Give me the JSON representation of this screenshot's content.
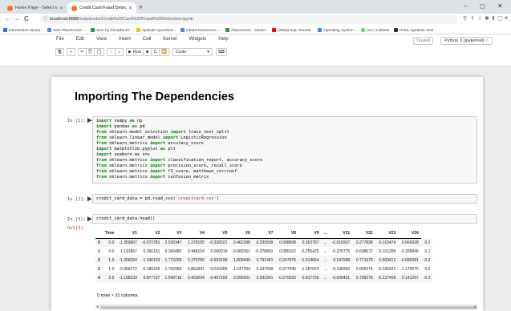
{
  "browser": {
    "tabs": [
      {
        "label": "Home Page - Select or create a n",
        "icon_color": "#f37626"
      },
      {
        "label": "Credit Card Fraud Detection - Ju",
        "icon_color": "#f37626"
      }
    ],
    "new_tab": "+",
    "window_controls": [
      "–",
      "◻",
      "✕"
    ],
    "nav": {
      "back": "←",
      "forward": "→",
      "reload": "C",
      "home": "⌂"
    },
    "url_host": "localhost:8888",
    "url_path": "/notebooks/Credit%20Card%20Fraud%20Detection.ipynb",
    "right_icons": [
      "⚲",
      "⇪",
      "☆",
      "✱",
      "⬇",
      "▢",
      "●"
    ],
    "bookmarks": [
      {
        "label": "Introduction: Boots...",
        "color": "#1a73e8"
      },
      {
        "label": "Tech Placements -...",
        "color": "#4285f4"
      },
      {
        "label": "DSA by Shradha Di...",
        "color": "#0f9d58"
      },
      {
        "label": "Aptitude Questions...",
        "color": "#fbbc05"
      },
      {
        "label": "DBMS Resources -...",
        "color": "#4285f4"
      },
      {
        "label": "Placements - Geeks...",
        "color": "#2f8d46"
      },
      {
        "label": "(2568) SQL Tutorial...",
        "color": "#ff0000"
      },
      {
        "label": "Operating System...",
        "color": "#4285f4"
      },
      {
        "label": "Live | Linktree",
        "color": "#43e55e"
      },
      {
        "label": "HTML Symbols, Enti...",
        "color": "#333333"
      }
    ]
  },
  "jupyter": {
    "menu": [
      "File",
      "Edit",
      "View",
      "Insert",
      "Cell",
      "Kernel",
      "Widgets",
      "Help"
    ],
    "trusted": "Trusted",
    "kernel": "Python 3 (ipykernel)",
    "kernel_indicator": "○",
    "toolbar": {
      "save": "🖫",
      "add": "+",
      "cut": "✂",
      "copy": "⎘",
      "paste": "📋",
      "up": "↑",
      "down": "↓",
      "run": "▶ Run",
      "stop": "■",
      "restart": "C",
      "restart_run": "⏩",
      "cell_type": "Code",
      "keyboard": "⌨"
    }
  },
  "notebook": {
    "heading": "Importing The Dependencies",
    "cells": [
      {
        "prompt": "In [1]:",
        "lines": [
          [
            [
              "kw",
              "import"
            ],
            [
              "t",
              " numpy "
            ],
            [
              "kw",
              "as"
            ],
            [
              "t",
              " np"
            ]
          ],
          [
            [
              "kw",
              "import"
            ],
            [
              "t",
              " pandas "
            ],
            [
              "kw",
              "as"
            ],
            [
              "t",
              " pd"
            ]
          ],
          [
            [
              "kw",
              "from"
            ],
            [
              "t",
              " sklearn.model_selection "
            ],
            [
              "kw",
              "import"
            ],
            [
              "t",
              " train_test_split"
            ]
          ],
          [
            [
              "kw",
              "from"
            ],
            [
              "t",
              " sklearn.linear_model "
            ],
            [
              "kw",
              "import"
            ],
            [
              "t",
              " LogisticRegression"
            ]
          ],
          [
            [
              "kw",
              "from"
            ],
            [
              "t",
              " sklearn.metrics "
            ],
            [
              "kw",
              "import"
            ],
            [
              "t",
              " accuracy_score"
            ]
          ],
          [
            [
              "kw",
              "import"
            ],
            [
              "t",
              " matplotlib.pyplot "
            ],
            [
              "kw",
              "as"
            ],
            [
              "t",
              " plt"
            ]
          ],
          [
            [
              "kw",
              "import"
            ],
            [
              "t",
              " seaborn "
            ],
            [
              "kw",
              "as"
            ],
            [
              "t",
              " sns"
            ]
          ],
          [
            [
              "kw",
              "from"
            ],
            [
              "t",
              " sklearn.metrics "
            ],
            [
              "kw",
              "import"
            ],
            [
              "t",
              " classification_report, accuracy_score"
            ]
          ],
          [
            [
              "kw",
              "from"
            ],
            [
              "t",
              " sklearn.metrics "
            ],
            [
              "kw",
              "import"
            ],
            [
              "t",
              " precision_score, recall_score"
            ]
          ],
          [
            [
              "kw",
              "from"
            ],
            [
              "t",
              " sklearn.metrics "
            ],
            [
              "kw",
              "import"
            ],
            [
              "t",
              " f1_score, matthews_corrcoef"
            ]
          ],
          [
            [
              "kw",
              "from"
            ],
            [
              "t",
              " sklearn.metrics "
            ],
            [
              "kw",
              "import"
            ],
            [
              "t",
              " confusion_matrix"
            ]
          ]
        ]
      },
      {
        "prompt": "In [2]:",
        "lines": [
          [
            [
              "t",
              "credit_card_data = pd.read_csv("
            ],
            [
              "str",
              "'creditcard.csv'"
            ],
            [
              "t",
              ")"
            ]
          ]
        ]
      },
      {
        "prompt": "In [3]:",
        "lines": [
          [
            [
              "t",
              "credit_card_data.head()"
            ]
          ]
        ]
      }
    ],
    "out_prompt": "Out[3]:",
    "dataframe": {
      "columns": [
        "",
        "Time",
        "V1",
        "V2",
        "V3",
        "V4",
        "V5",
        "V6",
        "V7",
        "V8",
        "V9",
        "...",
        "V21",
        "V22",
        "V23",
        "V24"
      ],
      "rows": [
        [
          "0",
          "0.0",
          "-1.359807",
          "-0.072781",
          "2.536347",
          "1.378155",
          "-0.338321",
          "0.462388",
          "0.239599",
          "0.098698",
          "0.363787",
          "...",
          "-0.018307",
          "0.277838",
          "-0.110474",
          "0.066928",
          "0.1"
        ],
        [
          "1",
          "0.0",
          "1.191857",
          "0.266151",
          "0.166480",
          "0.448154",
          "0.060018",
          "-0.082361",
          "-0.078803",
          "0.085102",
          "-0.255425",
          "...",
          "-0.225775",
          "-0.638672",
          "0.101288",
          "-0.339846",
          "0.1"
        ],
        [
          "2",
          "1.0",
          "-1.358354",
          "-1.340163",
          "1.773209",
          "0.379780",
          "-0.503198",
          "1.800499",
          "0.791461",
          "0.247676",
          "-1.514654",
          "...",
          "0.247998",
          "0.771679",
          "0.909412",
          "-0.689281",
          "-0.3"
        ],
        [
          "3",
          "1.0",
          "-0.966272",
          "-0.185226",
          "1.792993",
          "-0.863291",
          "-0.010309",
          "1.247203",
          "0.237609",
          "0.377436",
          "-1.387024",
          "...",
          "-0.108300",
          "0.005274",
          "-0.190321",
          "-1.175575",
          "0.6"
        ],
        [
          "4",
          "2.0",
          "-1.158233",
          "0.877737",
          "1.548718",
          "0.403034",
          "-0.407193",
          "0.095921",
          "0.592941",
          "-0.270533",
          "0.817739",
          "...",
          "-0.009431",
          "0.798278",
          "-0.137458",
          "0.141267",
          "-0.2"
        ]
      ],
      "footer": "5 rows × 31 columns"
    }
  }
}
